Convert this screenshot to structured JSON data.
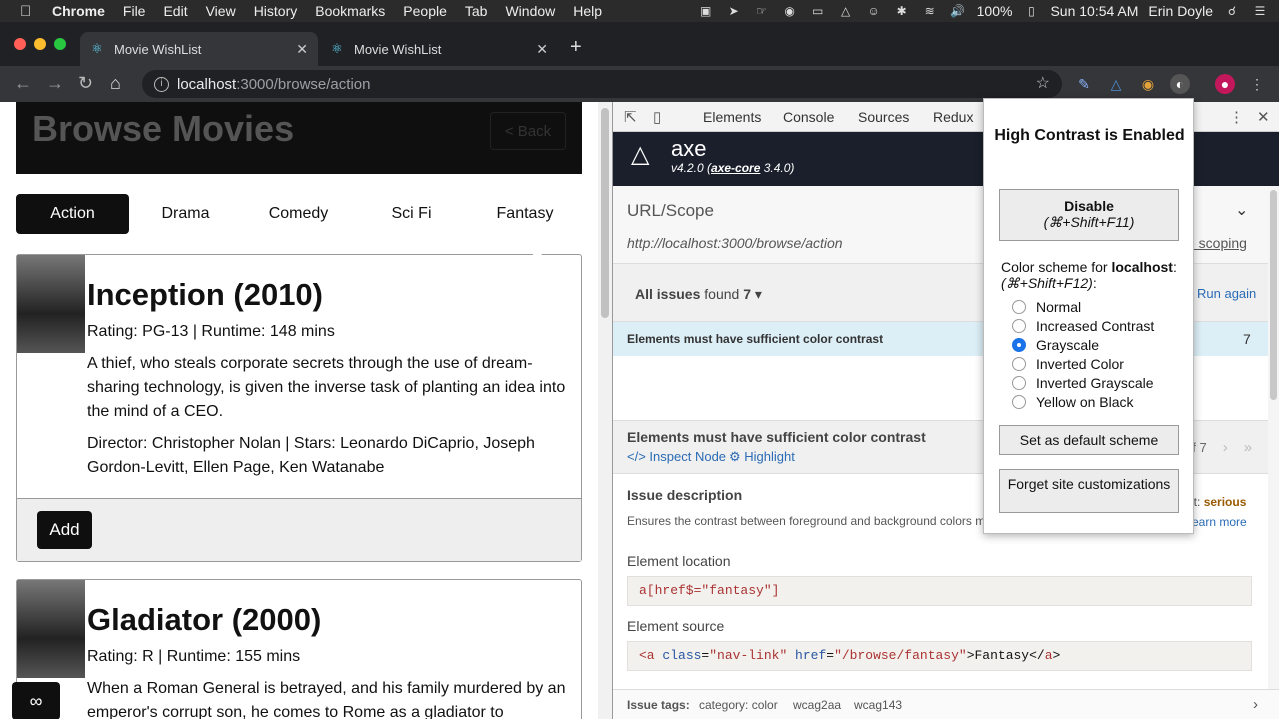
{
  "menubar": {
    "app": "Chrome",
    "menus": [
      "File",
      "Edit",
      "View",
      "History",
      "Bookmarks",
      "People",
      "Tab",
      "Window",
      "Help"
    ],
    "battery": "100%",
    "clock": "Sun 10:54 AM",
    "user": "Erin Doyle"
  },
  "tabs": [
    {
      "title": "Movie WishList"
    },
    {
      "title": "Movie WishList"
    }
  ],
  "omnibox": {
    "host": "localhost",
    "path": ":3000/browse/action"
  },
  "page": {
    "title": "Browse Movies",
    "back_label": "< Back",
    "genres": [
      "Action",
      "Drama",
      "Comedy",
      "Sci Fi",
      "Fantasy"
    ],
    "movies": [
      {
        "title": "Inception (2010)",
        "meta": "Rating: PG-13 | Runtime: 148 mins",
        "desc": "A thief, who steals corporate secrets through the use of dream-sharing technology, is given the inverse task of planting an idea into the mind of a CEO.",
        "crew": "Director: Christopher Nolan | Stars: Leonardo DiCaprio, Joseph Gordon-Levitt, Ellen Page, Ken Watanabe",
        "add_label": "Add"
      },
      {
        "title": "Gladiator (2000)",
        "meta": "Rating: R | Runtime: 155 mins",
        "desc": "When a Roman General is betrayed, and his family murdered by an emperor's corrupt son, he comes to Rome as a gladiator to"
      }
    ]
  },
  "devtools": {
    "tabs": [
      "Elements",
      "Console",
      "Sources",
      "Redux"
    ],
    "axe": {
      "name": "axe",
      "version_prefix": "v4.2.0 (",
      "core_name": "axe-core",
      "core_version": " 3.4.0)"
    },
    "scope": {
      "label": "URL/Scope",
      "url": "http://localhost:3000/browse/action",
      "scoping": "e scoping"
    },
    "issues": {
      "label": "All issues",
      "found_text": " found ",
      "count": "7",
      "run_again": "Run again"
    },
    "issue_row": {
      "title": "Elements must have sufficient color contrast",
      "count": "7"
    },
    "issue_detail": {
      "title": "Elements must have sufficient color contrast",
      "inspect": "Inspect Node",
      "highlight": "Highlight",
      "pager": "of 7"
    },
    "description": {
      "title": "Issue description",
      "text": "Ensures the contrast between foreground and background colors m ratio thresholds",
      "impact_label": "act: ",
      "impact_value": "serious",
      "learn_more": "earn more"
    },
    "location": {
      "title": "Element location",
      "code": "a[href$=\"fantasy\"]"
    },
    "source": {
      "title": "Element source",
      "code_parts": [
        "<a",
        " class",
        "=",
        "\"nav-link\"",
        " href",
        "=",
        "\"/browse/fantasy\"",
        ">Fantasy</",
        "a",
        ">"
      ]
    },
    "tags": {
      "label": "Issue tags:",
      "items": [
        "category: color",
        "wcag2aa",
        "wcag143"
      ]
    }
  },
  "hc_popup": {
    "title": "High Contrast is Enabled",
    "disable_label": "Disable",
    "disable_shortcut": "(⌘+Shift+F11)",
    "scheme_prefix": "Color scheme for ",
    "scheme_host": "localhost",
    "scheme_suffix": ":",
    "scheme_shortcut": "(⌘+Shift+F12)",
    "scheme_shortcut_suffix": ":",
    "options": [
      "Normal",
      "Increased Contrast",
      "Grayscale",
      "Inverted Color",
      "Inverted Grayscale",
      "Yellow on Black"
    ],
    "selected": "Grayscale",
    "default_label": "Set as default scheme",
    "forget_label": "Forget site customizations"
  },
  "colors": {
    "hero_bg": "#0f0f0f",
    "axe_header": "#1a1f2b",
    "link_blue": "#2a6bb5",
    "issue_row_bg": "#dceef6",
    "radio_selected": "#1a73e8"
  }
}
